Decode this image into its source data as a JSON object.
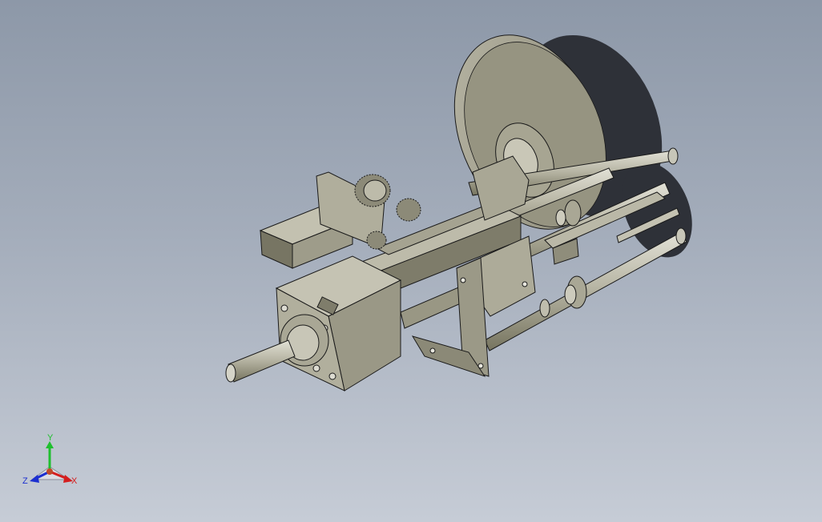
{
  "viewport": {
    "background_top": "#8d98a8",
    "background_bottom": "#c6ccd6"
  },
  "model": {
    "part_color": "#a3a18d",
    "part_shade": "#6f6d5e",
    "edge_color": "#1a1a1a"
  },
  "triad": {
    "x_label": "X",
    "y_label": "Y",
    "z_label": "Z",
    "x_color": "#d41e1e",
    "y_color": "#1fbf2e",
    "z_color": "#1c2fd0"
  }
}
